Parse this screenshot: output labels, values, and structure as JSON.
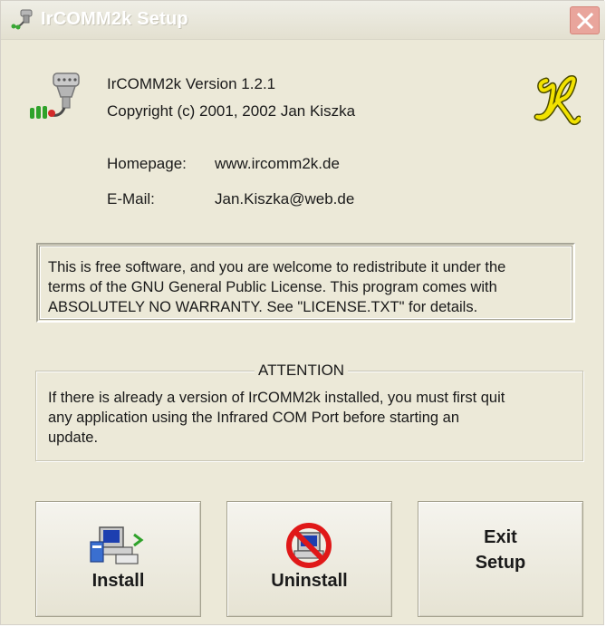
{
  "window": {
    "title": "IrCOMM2k Setup",
    "icons": {
      "title_icon": "serial-plug-icon",
      "close": "close-icon",
      "app": "ir-connector-icon",
      "logo": "script-k-logo-icon"
    }
  },
  "info": {
    "version_line": "IrCOMM2k Version 1.2.1",
    "copyright_line": "Copyright (c) 2001, 2002 Jan Kiszka",
    "homepage_label": "Homepage:",
    "homepage_value": "www.ircomm2k.de",
    "email_label": "E-Mail:",
    "email_value": "Jan.Kiszka@web.de"
  },
  "license": {
    "line1": "This is free software, and you are welcome to redistribute it under the",
    "line2": "terms of the GNU General Public License. This program comes with",
    "line3": "ABSOLUTELY NO WARRANTY. See \"LICENSE.TXT\" for details."
  },
  "attention": {
    "title": "ATTENTION",
    "line1": "If there is already a version of IrCOMM2k installed, you must first quit",
    "line2": "any application using the Infrared COM Port before starting an",
    "line3": "update."
  },
  "buttons": {
    "install": "Install",
    "uninstall": "Uninstall",
    "exit_line1": "Exit",
    "exit_line2": "Setup"
  },
  "colors": {
    "window_bg": "#ece9d8",
    "close_btn": "#e9a59c",
    "logo_yellow": "#f2e200",
    "no_sign_red": "#e01818"
  }
}
